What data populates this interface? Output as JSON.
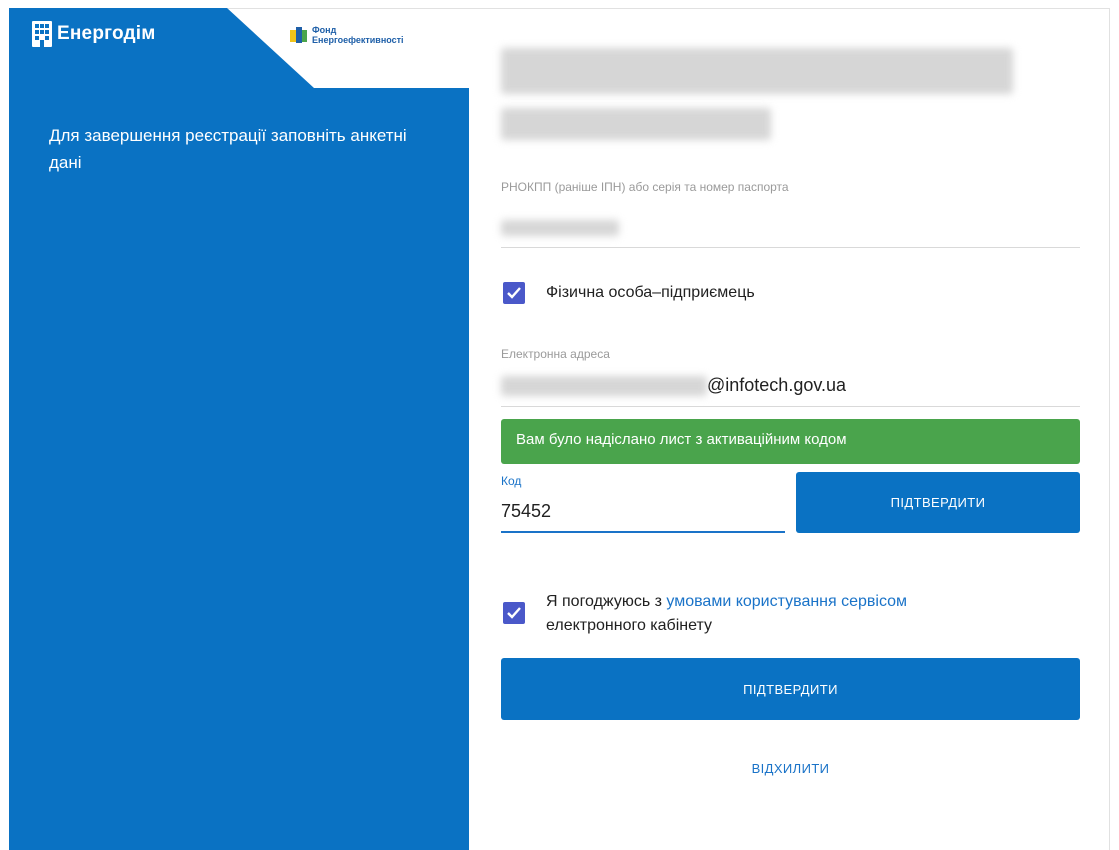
{
  "brand": {
    "name": "Енергодім",
    "fund_line1": "Фонд",
    "fund_line2": "Енергоефективності"
  },
  "intro": {
    "text": "Для завершення реєстрації заповніть анкетні дані"
  },
  "tax_id": {
    "label": "РНОКПП (раніше ІПН) або серія та номер паспорта"
  },
  "entrepreneur": {
    "label": "Фізична особа–підприємець",
    "checked": true
  },
  "email": {
    "label": "Електронна адреса",
    "domain": "@infotech.gov.ua"
  },
  "alert": {
    "text": "Вам було надіслано лист з активаційним кодом"
  },
  "code": {
    "label": "Код",
    "value": "75452",
    "confirm_label": "ПІДТВЕРДИТИ"
  },
  "terms": {
    "prefix": "Я погоджуюсь з ",
    "link": "умовами користування сервісом",
    "suffix": "електронного кабінету",
    "checked": true
  },
  "actions": {
    "submit_label": "ПІДТВЕРДИТИ",
    "decline_label": "ВІДХИЛИТИ"
  },
  "colors": {
    "panel": "#0a72c3",
    "primary": "#0a72c3",
    "success": "#4aa44c",
    "checkbox": "#4a58c9",
    "link": "#1a73c8"
  }
}
